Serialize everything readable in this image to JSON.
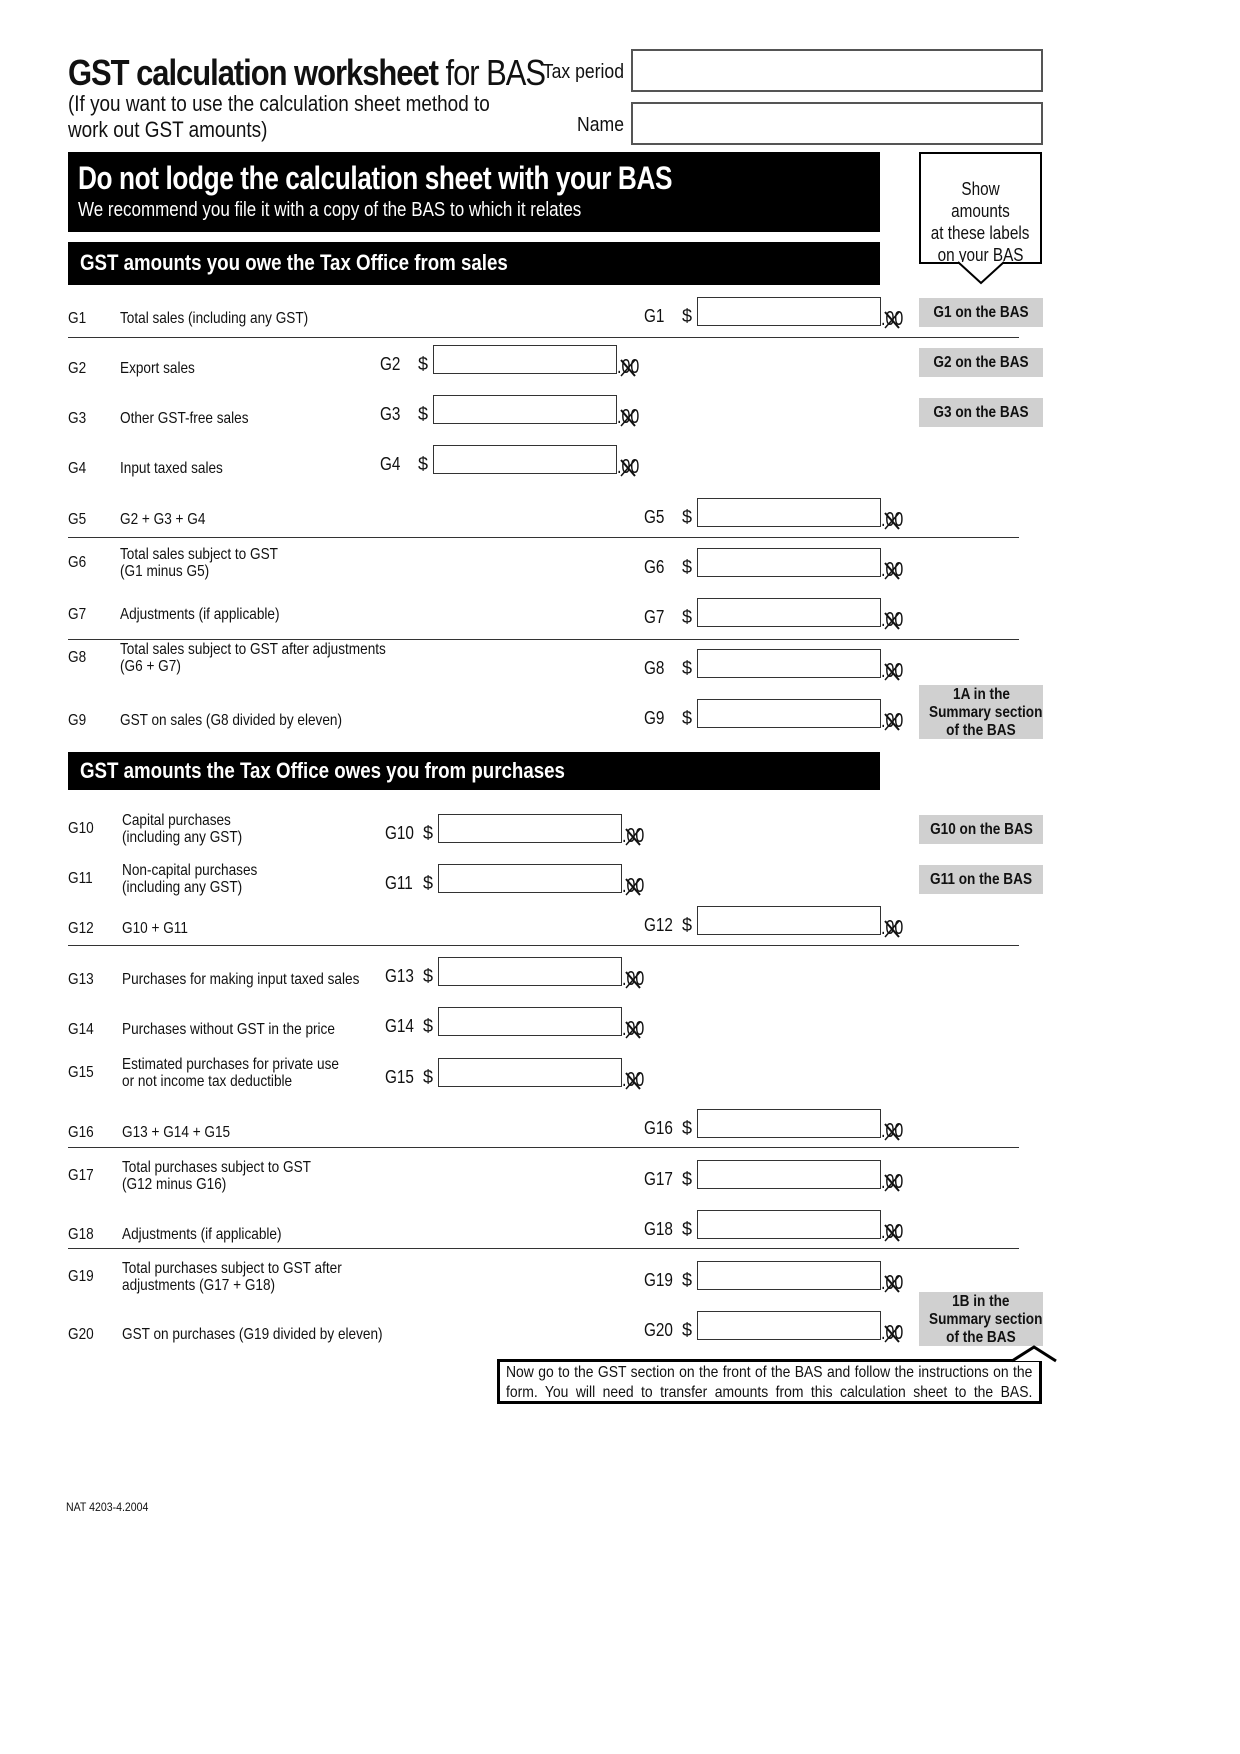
{
  "header": {
    "title_bold": "GST calculation worksheet",
    "title_regular": "for BAS",
    "subtitle_line1": "(If you want to use the calculation sheet method to",
    "subtitle_line2": "work out GST amounts)",
    "tax_period_label": "Tax period",
    "tax_period_value": "",
    "name_label": "Name",
    "name_value": ""
  },
  "banner": {
    "heading": "Do not lodge the calculation sheet with your BAS",
    "subheading": "We recommend you file it with a copy of the BAS to which it relates"
  },
  "callout": {
    "line1": "Show amounts",
    "line2": "at these labels",
    "line3": "on your BAS"
  },
  "currency_symbol": "$",
  "cents_text": ".00",
  "sections": {
    "sales": {
      "title": "GST amounts you owe the Tax Office from sales"
    },
    "purchases": {
      "title": "GST amounts the Tax Office owes you from purchases"
    }
  },
  "rows": {
    "G1": {
      "code": "G1",
      "desc1": "Total sales (including any GST)",
      "desc2": "",
      "field_label": "G1",
      "value": ""
    },
    "G2": {
      "code": "G2",
      "desc1": "Export sales",
      "desc2": "",
      "field_label": "G2",
      "value": ""
    },
    "G3": {
      "code": "G3",
      "desc1": "Other GST-free sales",
      "desc2": "",
      "field_label": "G3",
      "value": ""
    },
    "G4": {
      "code": "G4",
      "desc1": "Input taxed sales",
      "desc2": "",
      "field_label": "G4",
      "value": ""
    },
    "G5": {
      "code": "G5",
      "desc1": "G2 + G3 + G4",
      "desc2": "",
      "field_label": "G5",
      "value": ""
    },
    "G6": {
      "code": "G6",
      "desc1": "Total sales subject to GST",
      "desc2": "(G1 minus G5)",
      "field_label": "G6",
      "value": ""
    },
    "G7": {
      "code": "G7",
      "desc1": "Adjustments (if applicable)",
      "desc2": "",
      "field_label": "G7",
      "value": ""
    },
    "G8": {
      "code": "G8",
      "desc1": "Total sales subject to GST after adjustments",
      "desc2": "(G6 + G7)",
      "field_label": "G8",
      "value": ""
    },
    "G9": {
      "code": "G9",
      "desc1": "GST on sales (G8 divided by eleven)",
      "desc2": "",
      "field_label": "G9",
      "value": ""
    },
    "G10": {
      "code": "G10",
      "desc1": "Capital purchases",
      "desc2": "(including any GST)",
      "field_label": "G10",
      "value": ""
    },
    "G11": {
      "code": "G11",
      "desc1": "Non-capital purchases",
      "desc2": "(including any GST)",
      "field_label": "G11",
      "value": ""
    },
    "G12": {
      "code": "G12",
      "desc1": "G10 + G11",
      "desc2": "",
      "field_label": "G12",
      "value": ""
    },
    "G13": {
      "code": "G13",
      "desc1": "Purchases for making input taxed sales",
      "desc2": "",
      "field_label": "G13",
      "value": ""
    },
    "G14": {
      "code": "G14",
      "desc1": "Purchases without GST in the price",
      "desc2": "",
      "field_label": "G14",
      "value": ""
    },
    "G15": {
      "code": "G15",
      "desc1": "Estimated purchases for private use",
      "desc2": "or not income tax deductible",
      "field_label": "G15",
      "value": ""
    },
    "G16": {
      "code": "G16",
      "desc1": "G13 + G14 + G15",
      "desc2": "",
      "field_label": "G16",
      "value": ""
    },
    "G17": {
      "code": "G17",
      "desc1": "Total purchases subject to GST",
      "desc2": "(G12 minus G16)",
      "field_label": "G17",
      "value": ""
    },
    "G18": {
      "code": "G18",
      "desc1": "Adjustments (if applicable)",
      "desc2": "",
      "field_label": "G18",
      "value": ""
    },
    "G19": {
      "code": "G19",
      "desc1": "Total purchases subject to GST after",
      "desc2": "adjustments (G17 + G18)",
      "field_label": "G19",
      "value": ""
    },
    "G20": {
      "code": "G20",
      "desc1": "GST on purchases (G19 divided by eleven)",
      "desc2": "",
      "field_label": "G20",
      "value": ""
    }
  },
  "bas_tags": {
    "G1": "G1 on the BAS",
    "G2": "G2 on the BAS",
    "G3": "G3 on the BAS",
    "one_a": [
      "1A in the",
      "Summary section",
      "of the BAS"
    ],
    "G10": "G10 on the BAS",
    "G11": "G11 on the BAS",
    "one_b": [
      "1B in the",
      "Summary section",
      "of the BAS"
    ]
  },
  "note": "Now go to the GST section on the front of the BAS and follow the instructions on the form. You will need to transfer amounts from this calculation sheet to the BAS.",
  "footer": "NAT 4203-4.2004",
  "colors": {
    "banner_bg": "#000000",
    "tag_bg": "#d0d0d0"
  }
}
